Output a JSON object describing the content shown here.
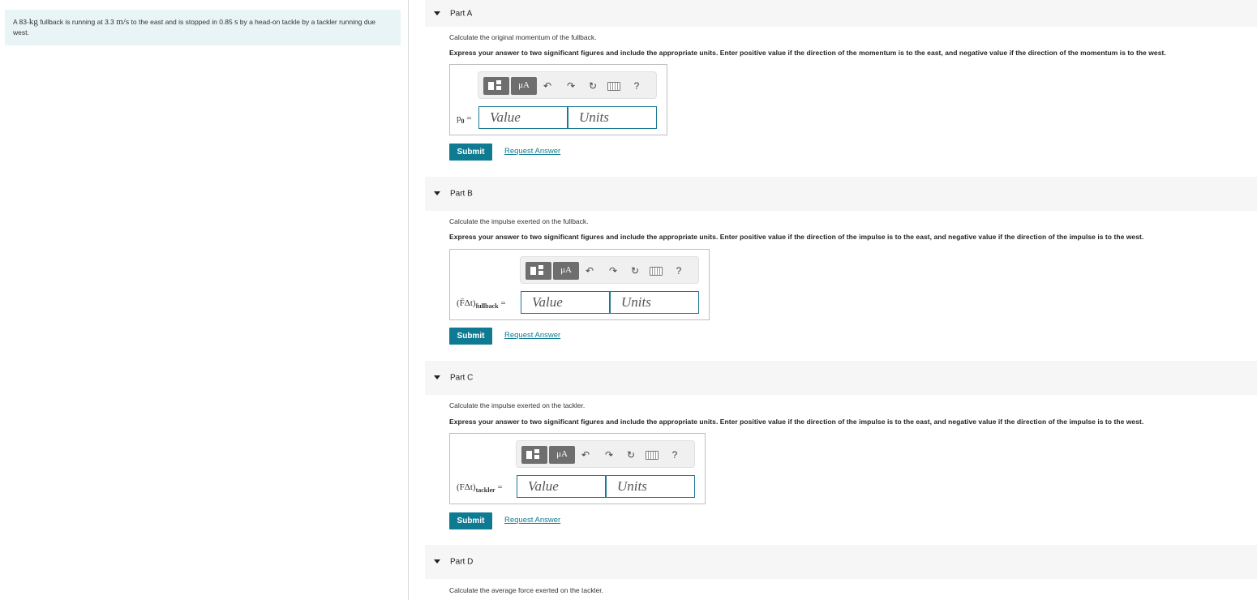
{
  "problem": {
    "text_1": "A 83-",
    "mass_unit": "kg",
    "text_2": " fullback is running at 3.3 ",
    "speed_unit": "m/s",
    "text_3": " to the east and is stopped in 0.85 ",
    "time_unit": "s",
    "text_4": " by a head-on tackle by a tackler running due west."
  },
  "parts": [
    {
      "title": "Part A",
      "prompt": "Calculate the original momentum of the fullback.",
      "instructions": "Express your answer to two significant figures and include the appropriate units. Enter positive value if the direction of the momentum is to the east, and negative value if the direction of the momentum is to the west.",
      "var_main": "p",
      "var_sub": "0",
      "var_rest": "",
      "value_placeholder": "Value",
      "units_placeholder": "Units",
      "submit": "Submit",
      "request": "Request Answer"
    },
    {
      "title": "Part B",
      "prompt": "Calculate the impulse exerted on the fullback.",
      "instructions": "Express your answer to two significant figures and include the appropriate units. Enter positive value if the direction of the impulse is to the east, and negative value if the direction of the impulse is to the west.",
      "var_main": "(F̄Δt)",
      "var_sub": "fullback",
      "value_placeholder": "Value",
      "units_placeholder": "Units",
      "submit": "Submit",
      "request": "Request Answer"
    },
    {
      "title": "Part C",
      "prompt": "Calculate the impulse exerted on the tackler.",
      "instructions": "Express your answer to two significant figures and include the appropriate units. Enter positive value if the direction of the impulse is to the east, and negative value if the direction of the impulse is to the west.",
      "var_main": "(FΔt)",
      "var_sub": "tackler",
      "value_placeholder": "Value",
      "units_placeholder": "Units",
      "submit": "Submit",
      "request": "Request Answer"
    },
    {
      "title": "Part D",
      "prompt": "Calculate the average force exerted on the tackler."
    }
  ],
  "toolbar": {
    "mu_label": "μA",
    "help_label": "?",
    "undo_icon": "undo-icon",
    "redo_icon": "redo-icon",
    "reset_icon": "reset-icon",
    "keyboard_icon": "keyboard-icon"
  },
  "equals": "="
}
